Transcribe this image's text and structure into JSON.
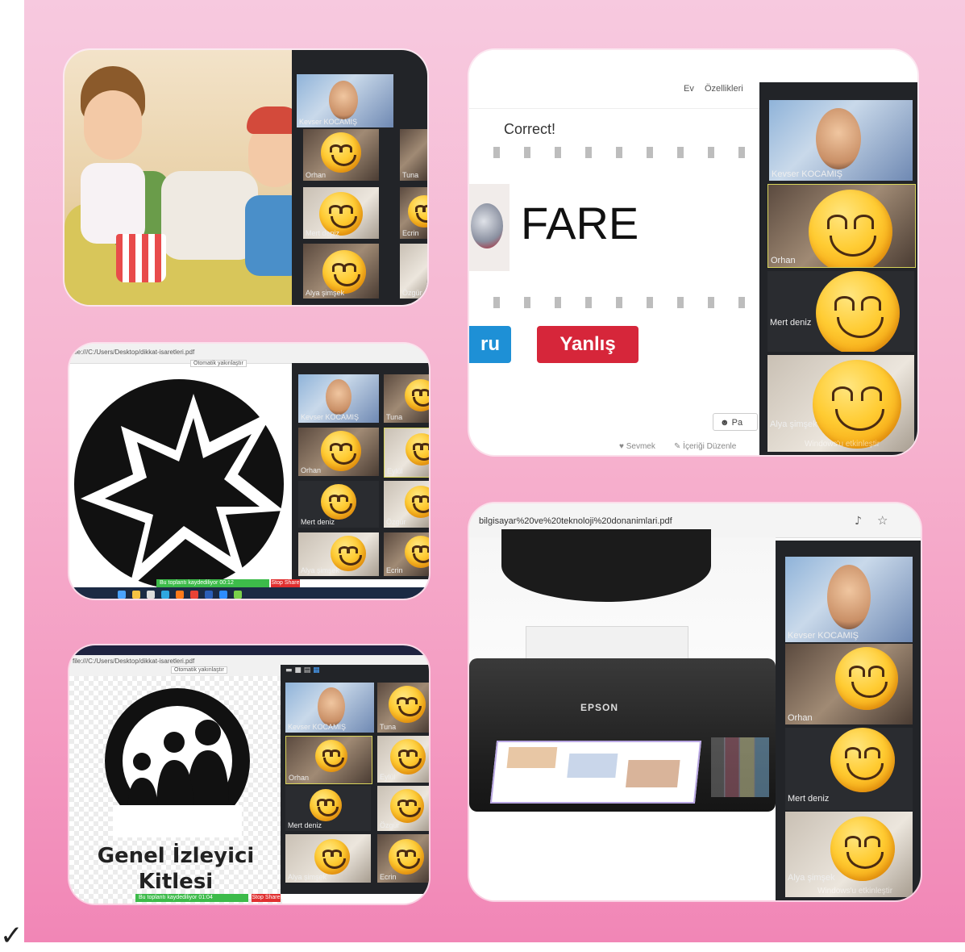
{
  "corner_mark": "✓",
  "card1": {
    "tiles": [
      {
        "name": "Kevser KOCAMIŞ"
      },
      {
        "name": "Orhan"
      },
      {
        "name": "Mert deniz"
      },
      {
        "name": "Alya şimşek"
      }
    ],
    "right_labels": [
      "Tuna",
      "Ecrin",
      "Özgür"
    ]
  },
  "card2": {
    "nav": {
      "home": "Ev",
      "features": "Özellikleri"
    },
    "feedback": "Correct!",
    "word": "FARE",
    "btn_true_partial": "ru",
    "btn_false": "Yanlış",
    "share_partial": "Pa",
    "footer": {
      "like": "Sevmek",
      "edit": "İçeriği Düzenle"
    },
    "tiles": [
      {
        "name": "Kevser KOCAMIŞ"
      },
      {
        "name": "Orhan"
      },
      {
        "name": "Mert deniz"
      },
      {
        "name": "Alya şimşek"
      }
    ],
    "windows_watermark": "Windows'u etkinleştir"
  },
  "card3": {
    "url": "file:///C:/Users/Desktop/dikkat-isaretleri.pdf",
    "zoom": "Otomatik yakınlaştır",
    "tiles": [
      {
        "name": "Kevser KOCAMIŞ"
      },
      {
        "name": "Orhan"
      },
      {
        "name": "Mert deniz"
      },
      {
        "name": "Alya şimşek"
      }
    ],
    "right_labels": [
      "Tuna",
      "Eylül",
      "Özgür",
      "Ecrin"
    ],
    "meeting_bar": "Bu toplantı kaydediliyor 00:12",
    "stop_share": "Stop Share"
  },
  "card4": {
    "url": "bilgisayar%20ve%20teknoloji%20donanimlari.pdf",
    "printer_brand": "EPSON",
    "tiles": [
      {
        "name": "Kevser KOCAMIŞ"
      },
      {
        "name": "Orhan"
      },
      {
        "name": "Mert deniz"
      },
      {
        "name": "Alya şimşek"
      }
    ],
    "windows_watermark": "Windows'u etkinleştir"
  },
  "card5": {
    "url": "file:///C:/Users/Desktop/dikkat-isaretleri.pdf",
    "zoom": "Otomatik yakınlaştır",
    "caption_line1": "Genel İzleyici",
    "caption_line2": "Kitlesi",
    "tiles": [
      {
        "name": "Kevser KOCAMIŞ"
      },
      {
        "name": "Orhan"
      },
      {
        "name": "Mert deniz"
      },
      {
        "name": "Alya şimşek"
      }
    ],
    "right_labels": [
      "Tuna",
      "Eylül",
      "Özgür",
      "Ecrin"
    ],
    "meeting_bar": "Bu toplantı kaydediliyor 01:04",
    "stop_share": "Stop Share"
  },
  "colors": {
    "bg_top": "#f7c9df",
    "bg_bottom": "#f186b6",
    "panel": "#222428",
    "correct_btn": "#1e90d6",
    "wrong_btn": "#d6263a"
  }
}
